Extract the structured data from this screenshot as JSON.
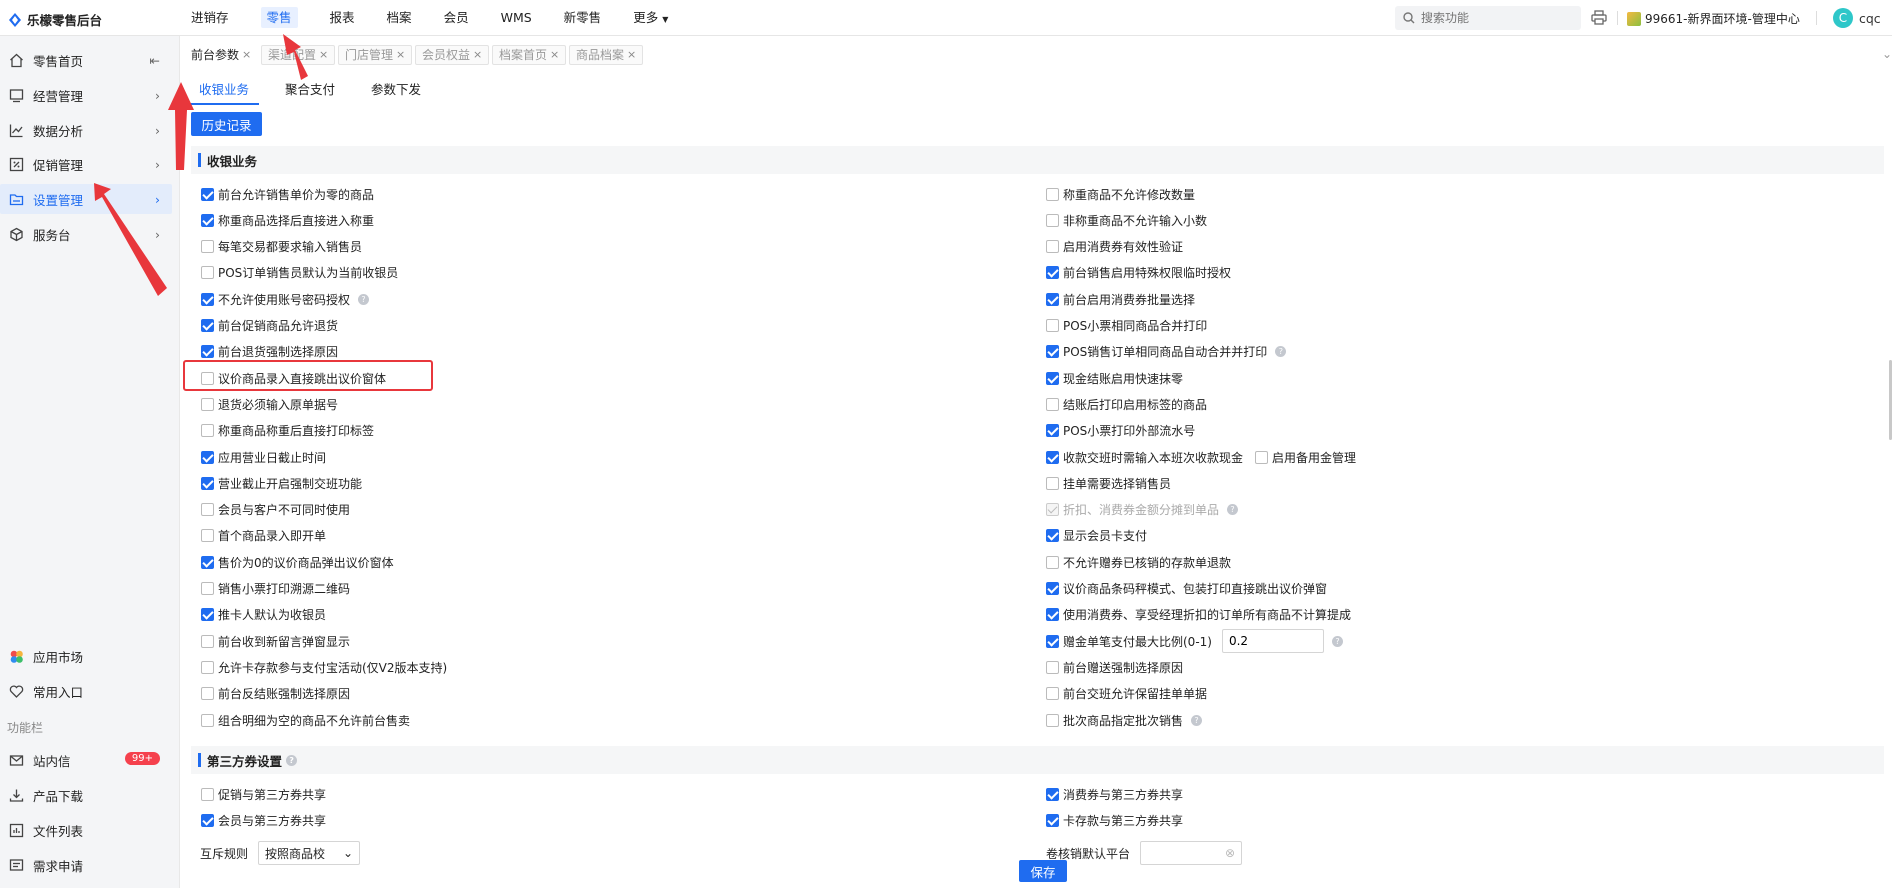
{
  "app": {
    "title": "乐檬零售后台"
  },
  "topnav": [
    "进销存",
    "零售",
    "报表",
    "档案",
    "会员",
    "WMS",
    "新零售",
    "更多"
  ],
  "search": {
    "placeholder": "搜索功能"
  },
  "store": "99661-新界面环境-管理中心",
  "user": {
    "avatar_letter": "C",
    "name": "cqc"
  },
  "sidebar": {
    "items": [
      "零售首页",
      "经营管理",
      "数据分析",
      "促销管理",
      "设置管理",
      "服务台"
    ],
    "bottom": [
      "应用市场",
      "常用入口"
    ],
    "section": "功能栏",
    "func_items": [
      "站内信",
      "产品下载",
      "文件列表",
      "需求申请"
    ],
    "badge": "99+"
  },
  "tabs": [
    "前台参数",
    "渠道配置",
    "门店管理",
    "会员权益",
    "档案首页",
    "商品档案"
  ],
  "subtabs": [
    "收银业务",
    "聚合支付",
    "参数下发"
  ],
  "history_button": "历史记录",
  "section1": {
    "title": "收银业务",
    "left": [
      {
        "label": "前台允许销售单价为零的商品",
        "checked": true
      },
      {
        "label": "称重商品选择后直接进入称重",
        "checked": true
      },
      {
        "label": "每笔交易都要求输入销售员",
        "checked": false
      },
      {
        "label": "POS订单销售员默认为当前收银员",
        "checked": false
      },
      {
        "label": "不允许使用账号密码授权",
        "checked": true
      },
      {
        "label": "前台促销商品允许退货",
        "checked": true
      },
      {
        "label": "前台退货强制选择原因",
        "checked": true
      },
      {
        "label": "议价商品录入直接跳出议价窗体",
        "checked": false
      },
      {
        "label": "退货必须输入原单据号",
        "checked": false
      },
      {
        "label": "称重商品称重后直接打印标签",
        "checked": false
      },
      {
        "label": "应用营业日截止时间",
        "checked": true
      },
      {
        "label": "营业截止开启强制交班功能",
        "checked": true
      },
      {
        "label": "会员与客户不可同时使用",
        "checked": false
      },
      {
        "label": "首个商品录入即开单",
        "checked": false
      },
      {
        "label": "售价为0的议价商品弹出议价窗体",
        "checked": true
      },
      {
        "label": "销售小票打印溯源二维码",
        "checked": false
      },
      {
        "label": "推卡人默认为收银员",
        "checked": true
      },
      {
        "label": "前台收到新留言弹窗显示",
        "checked": false
      },
      {
        "label": "允许卡存款参与支付宝活动(仅V2版本支持)",
        "checked": false
      },
      {
        "label": "前台反结账强制选择原因",
        "checked": false
      },
      {
        "label": "组合明细为空的商品不允许前台售卖",
        "checked": false
      }
    ],
    "right": [
      {
        "label": "称重商品不允许修改数量",
        "checked": false
      },
      {
        "label": "非称重商品不允许输入小数",
        "checked": false
      },
      {
        "label": "启用消费券有效性验证",
        "checked": false
      },
      {
        "label": "前台销售启用特殊权限临时授权",
        "checked": true
      },
      {
        "label": "前台启用消费券批量选择",
        "checked": true
      },
      {
        "label": "POS小票相同商品合并打印",
        "checked": false
      },
      {
        "label": "POS销售订单相同商品自动合并并打印",
        "checked": true
      },
      {
        "label": "现金结账启用快速抹零",
        "checked": true
      },
      {
        "label": "结账后打印启用标签的商品",
        "checked": false
      },
      {
        "label": "POS小票打印外部流水号",
        "checked": true
      },
      {
        "label": "收款交班时需输入本班次收款现金",
        "checked": true
      },
      {
        "label": "挂单需要选择销售员",
        "checked": false
      },
      {
        "label": "折扣、消费券金额分摊到单品",
        "checked": true
      },
      {
        "label": "显示会员卡支付",
        "checked": true
      },
      {
        "label": "不允许赠券已核销的存款单退款",
        "checked": false
      },
      {
        "label": "议价商品条码秤模式、包装打印直接跳出议价弹窗",
        "checked": true
      },
      {
        "label": "使用消费券、享受经理折扣的订单所有商品不计算提成",
        "checked": true
      },
      {
        "label": "赠金单笔支付最大比例(0-1)",
        "checked": true
      },
      {
        "label": "前台赠送强制选择原因",
        "checked": false
      },
      {
        "label": "前台交班允许保留挂单单据",
        "checked": false
      },
      {
        "label": "批次商品指定批次销售",
        "checked": false
      }
    ],
    "extra_label": "启用备用金管理",
    "ratio_value": "0.2"
  },
  "section2": {
    "title": "第三方券设置",
    "left": [
      {
        "label": "促销与第三方券共享",
        "checked": false
      },
      {
        "label": "会员与第三方券共享",
        "checked": true
      }
    ],
    "right": [
      {
        "label": "消费券与第三方券共享",
        "checked": true
      },
      {
        "label": "卡存款与第三方券共享",
        "checked": true
      }
    ],
    "rule_label": "互斥规则",
    "rule_value": "按照商品校",
    "platform_label": "卷核销默认平台"
  },
  "save_button": "保存"
}
